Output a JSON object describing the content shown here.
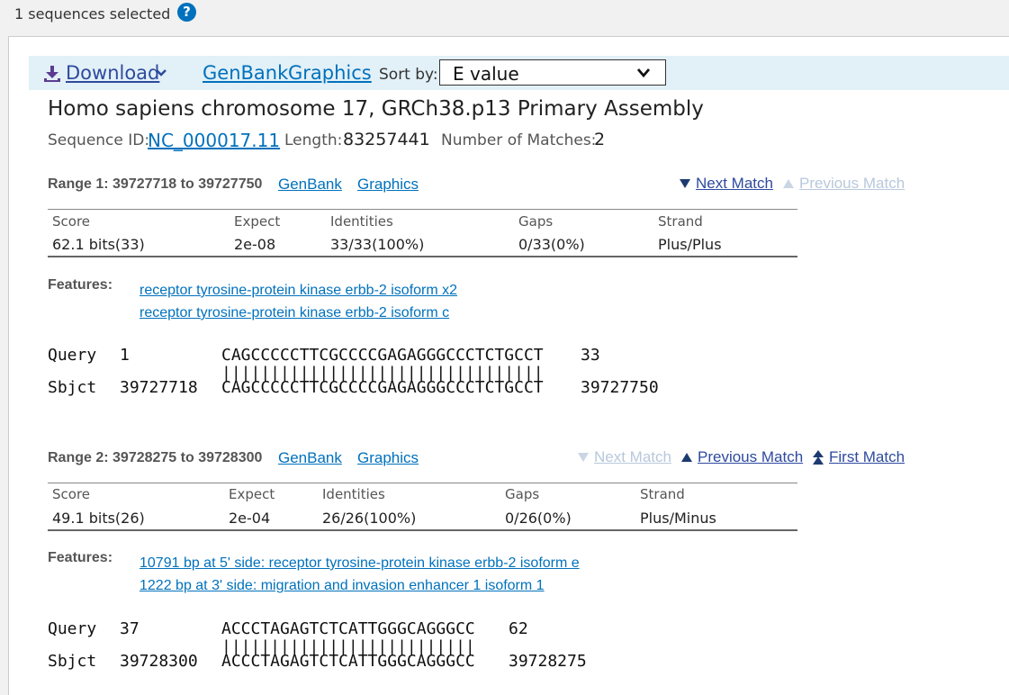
{
  "header": {
    "selection_text": "1 sequences selected",
    "help_glyph": "?"
  },
  "toolbar": {
    "download_label": "Download",
    "genbank_label": "GenBank",
    "graphics_label": "Graphics",
    "sort_label": "Sort by:",
    "sort_value": "E value"
  },
  "sequence": {
    "title": "Homo sapiens chromosome 17, GRCh38.p13 Primary Assembly",
    "id_label": "Sequence ID:",
    "id_value": "NC_000017.11",
    "length_label": "Length:",
    "length_value": "83257441",
    "matches_label": "Number of Matches:",
    "matches_value": "2"
  },
  "stat_headers": {
    "score": "Score",
    "expect": "Expect",
    "identities": "Identities",
    "gaps": "Gaps",
    "strand": "Strand"
  },
  "features_label": "Features:",
  "ranges": [
    {
      "label": "Range 1: 39727718 to 39727750",
      "genbank": "GenBank",
      "graphics": "Graphics",
      "next_match": "Next Match",
      "previous_match": "Previous Match",
      "score": "62.1 bits(33)",
      "expect": "2e-08",
      "identities": "33/33(100%)",
      "gaps": "0/33(0%)",
      "strand": "Plus/Plus",
      "features": [
        "receptor tyrosine-protein kinase erbb-2 isoform x2",
        "receptor tyrosine-protein kinase erbb-2 isoform c"
      ],
      "query_label": "Query",
      "query_start": "1",
      "query_seq": "CAGCCCCCTTCGCCCCGAGAGGGCCCTCTGCCT",
      "query_end": "33",
      "match_line": "|||||||||||||||||||||||||||||||||",
      "sbjct_label": "Sbjct",
      "sbjct_start": "39727718",
      "sbjct_seq": "CAGCCCCCTTCGCCCCGAGAGGGCCCTCTGCCT",
      "sbjct_end": "39727750"
    },
    {
      "label": "Range 2: 39728275 to 39728300",
      "genbank": "GenBank",
      "graphics": "Graphics",
      "next_match": "Next Match",
      "previous_match": "Previous Match",
      "first_match": "First Match",
      "score": "49.1 bits(26)",
      "expect": "2e-04",
      "identities": "26/26(100%)",
      "gaps": "0/26(0%)",
      "strand": "Plus/Minus",
      "features": [
        "10791 bp at 5' side: receptor tyrosine-protein kinase erbb-2 isoform e",
        "1222 bp at 3' side: migration and invasion enhancer 1 isoform 1"
      ],
      "query_label": "Query",
      "query_start": "37",
      "query_seq": "ACCCTAGAGTCTCATTGGGCAGGGCC",
      "query_end": "62",
      "match_line": "||||||||||||||||||||||||||",
      "sbjct_label": "Sbjct",
      "sbjct_start": "39728300",
      "sbjct_seq": "ACCCTAGAGTCTCATTGGGCAGGGCC",
      "sbjct_end": "39728275"
    }
  ]
}
